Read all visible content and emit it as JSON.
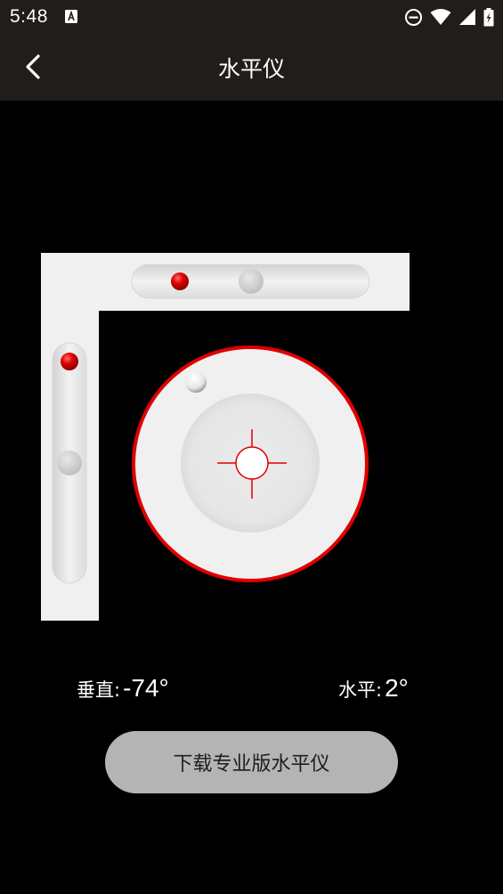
{
  "status_bar": {
    "time": "5:48",
    "icons": [
      "a-icon",
      "dnd-icon",
      "wifi-icon",
      "signal-icon",
      "battery-icon"
    ]
  },
  "app_bar": {
    "title": "水平仪",
    "back_icon": "chevron-left-icon"
  },
  "levels": {
    "accent_color": "#e00000",
    "vertical": {
      "label": "垂直:",
      "value": "-74°"
    },
    "horizontal": {
      "label": "水平:",
      "value": "2°"
    }
  },
  "pro_button": {
    "label": "下载专业版水平仪"
  }
}
